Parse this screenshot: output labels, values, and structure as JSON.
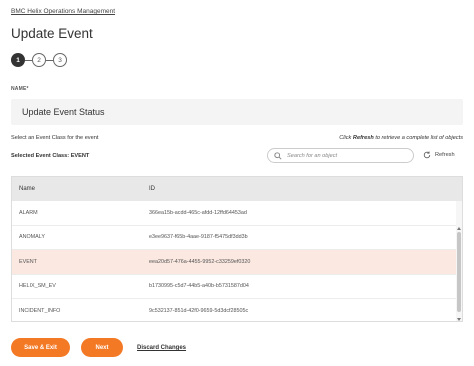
{
  "breadcrumb": "BMC Helix Operations Management",
  "page_title": "Update Event",
  "stepper": {
    "steps": [
      "1",
      "2",
      "3"
    ],
    "active": 1
  },
  "name_label": "NAME*",
  "name_value": "Update Event Status",
  "instructions": {
    "left": "Select an Event Class for the event",
    "right_prefix": "Click ",
    "right_bold": "Refresh",
    "right_suffix": " to retrieve a complete list of objects"
  },
  "selected_class": "Selected Event Class: EVENT",
  "search": {
    "placeholder": "Search for an object",
    "icon": "search-icon"
  },
  "refresh_label": "Refresh",
  "table": {
    "headers": {
      "name": "Name",
      "id": "ID"
    },
    "rows": [
      {
        "name": "ALARM",
        "id": "366ea15b-acdd-465c-afdd-12ffd64453ad",
        "selected": false
      },
      {
        "name": "ANOMALY",
        "id": "e3ee9637-f65b-4aae-9187-f5475df3dd3b",
        "selected": false
      },
      {
        "name": "EVENT",
        "id": "eea20d57-476a-4455-9952-c33259ef0320",
        "selected": true
      },
      {
        "name": "HELIX_SM_EV",
        "id": "b1730995-c5d7-44b5-a40b-b5731587d04",
        "selected": false
      },
      {
        "name": "INCIDENT_INFO",
        "id": "9c532137-851d-42f0-9659-5d3dcf28505c",
        "selected": false
      }
    ]
  },
  "buttons": {
    "save_exit": "Save & Exit",
    "next": "Next",
    "discard": "Discard Changes"
  },
  "colors": {
    "accent": "#f47925",
    "selected_row": "#fbe8e1"
  }
}
